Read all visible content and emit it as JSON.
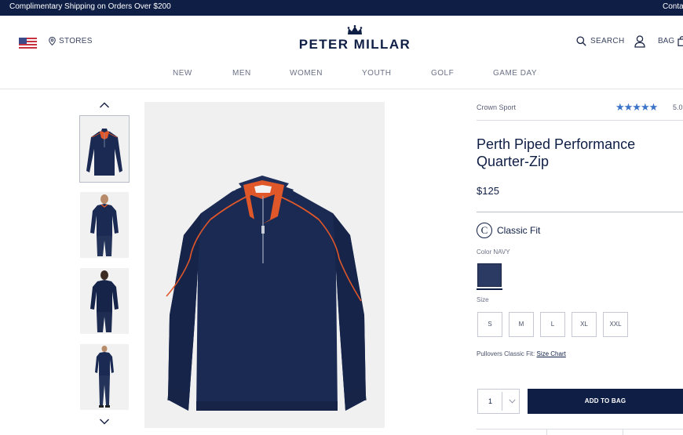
{
  "promo": {
    "left_text": "Complimentary Shipping on Orders Over $200",
    "right_text": "Conta"
  },
  "header": {
    "stores_label": "STORES",
    "logo_text": "PETER MILLAR",
    "search_label": "SEARCH",
    "bag_label": "BAG"
  },
  "nav": {
    "items": [
      "NEW",
      "MEN",
      "WOMEN",
      "YOUTH",
      "GOLF",
      "GAME DAY"
    ]
  },
  "product": {
    "brand_line": "Crown Sport",
    "rating_stars": "★★★★★",
    "rating_value": "5.0",
    "title": "Perth Piped Performance Quarter-Zip",
    "price": "$125",
    "fit_icon_letter": "C",
    "fit_label": "Classic Fit",
    "color_label": "Color NAVY",
    "swatch_color": "#2a3a63",
    "size_label": "Size",
    "sizes": [
      "S",
      "M",
      "L",
      "XL",
      "XXL"
    ],
    "size_chart_prefix": "Pullovers Classic Fit:",
    "size_chart_link": "Size Chart",
    "quantity": "1",
    "add_to_bag_label": "ADD TO BAG"
  },
  "colors": {
    "navy": "#0f1e45",
    "garment": "#1b2a52",
    "piping": "#e0572a",
    "star": "#3a73c7"
  },
  "icons": {
    "flag": "us-flag-icon",
    "stores": "map-pin-icon",
    "search": "search-icon",
    "account": "user-icon",
    "bag": "bag-icon"
  }
}
